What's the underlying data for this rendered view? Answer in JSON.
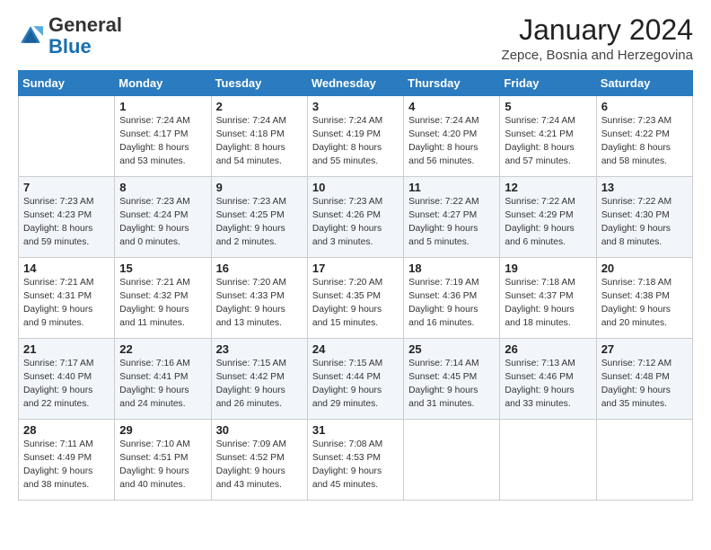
{
  "logo": {
    "general": "General",
    "blue": "Blue"
  },
  "header": {
    "month": "January 2024",
    "location": "Zepce, Bosnia and Herzegovina"
  },
  "days_of_week": [
    "Sunday",
    "Monday",
    "Tuesday",
    "Wednesday",
    "Thursday",
    "Friday",
    "Saturday"
  ],
  "weeks": [
    [
      {
        "day": "",
        "detail": ""
      },
      {
        "day": "1",
        "detail": "Sunrise: 7:24 AM\nSunset: 4:17 PM\nDaylight: 8 hours\nand 53 minutes."
      },
      {
        "day": "2",
        "detail": "Sunrise: 7:24 AM\nSunset: 4:18 PM\nDaylight: 8 hours\nand 54 minutes."
      },
      {
        "day": "3",
        "detail": "Sunrise: 7:24 AM\nSunset: 4:19 PM\nDaylight: 8 hours\nand 55 minutes."
      },
      {
        "day": "4",
        "detail": "Sunrise: 7:24 AM\nSunset: 4:20 PM\nDaylight: 8 hours\nand 56 minutes."
      },
      {
        "day": "5",
        "detail": "Sunrise: 7:24 AM\nSunset: 4:21 PM\nDaylight: 8 hours\nand 57 minutes."
      },
      {
        "day": "6",
        "detail": "Sunrise: 7:23 AM\nSunset: 4:22 PM\nDaylight: 8 hours\nand 58 minutes."
      }
    ],
    [
      {
        "day": "7",
        "detail": "Sunrise: 7:23 AM\nSunset: 4:23 PM\nDaylight: 8 hours\nand 59 minutes."
      },
      {
        "day": "8",
        "detail": "Sunrise: 7:23 AM\nSunset: 4:24 PM\nDaylight: 9 hours\nand 0 minutes."
      },
      {
        "day": "9",
        "detail": "Sunrise: 7:23 AM\nSunset: 4:25 PM\nDaylight: 9 hours\nand 2 minutes."
      },
      {
        "day": "10",
        "detail": "Sunrise: 7:23 AM\nSunset: 4:26 PM\nDaylight: 9 hours\nand 3 minutes."
      },
      {
        "day": "11",
        "detail": "Sunrise: 7:22 AM\nSunset: 4:27 PM\nDaylight: 9 hours\nand 5 minutes."
      },
      {
        "day": "12",
        "detail": "Sunrise: 7:22 AM\nSunset: 4:29 PM\nDaylight: 9 hours\nand 6 minutes."
      },
      {
        "day": "13",
        "detail": "Sunrise: 7:22 AM\nSunset: 4:30 PM\nDaylight: 9 hours\nand 8 minutes."
      }
    ],
    [
      {
        "day": "14",
        "detail": "Sunrise: 7:21 AM\nSunset: 4:31 PM\nDaylight: 9 hours\nand 9 minutes."
      },
      {
        "day": "15",
        "detail": "Sunrise: 7:21 AM\nSunset: 4:32 PM\nDaylight: 9 hours\nand 11 minutes."
      },
      {
        "day": "16",
        "detail": "Sunrise: 7:20 AM\nSunset: 4:33 PM\nDaylight: 9 hours\nand 13 minutes."
      },
      {
        "day": "17",
        "detail": "Sunrise: 7:20 AM\nSunset: 4:35 PM\nDaylight: 9 hours\nand 15 minutes."
      },
      {
        "day": "18",
        "detail": "Sunrise: 7:19 AM\nSunset: 4:36 PM\nDaylight: 9 hours\nand 16 minutes."
      },
      {
        "day": "19",
        "detail": "Sunrise: 7:18 AM\nSunset: 4:37 PM\nDaylight: 9 hours\nand 18 minutes."
      },
      {
        "day": "20",
        "detail": "Sunrise: 7:18 AM\nSunset: 4:38 PM\nDaylight: 9 hours\nand 20 minutes."
      }
    ],
    [
      {
        "day": "21",
        "detail": "Sunrise: 7:17 AM\nSunset: 4:40 PM\nDaylight: 9 hours\nand 22 minutes."
      },
      {
        "day": "22",
        "detail": "Sunrise: 7:16 AM\nSunset: 4:41 PM\nDaylight: 9 hours\nand 24 minutes."
      },
      {
        "day": "23",
        "detail": "Sunrise: 7:15 AM\nSunset: 4:42 PM\nDaylight: 9 hours\nand 26 minutes."
      },
      {
        "day": "24",
        "detail": "Sunrise: 7:15 AM\nSunset: 4:44 PM\nDaylight: 9 hours\nand 29 minutes."
      },
      {
        "day": "25",
        "detail": "Sunrise: 7:14 AM\nSunset: 4:45 PM\nDaylight: 9 hours\nand 31 minutes."
      },
      {
        "day": "26",
        "detail": "Sunrise: 7:13 AM\nSunset: 4:46 PM\nDaylight: 9 hours\nand 33 minutes."
      },
      {
        "day": "27",
        "detail": "Sunrise: 7:12 AM\nSunset: 4:48 PM\nDaylight: 9 hours\nand 35 minutes."
      }
    ],
    [
      {
        "day": "28",
        "detail": "Sunrise: 7:11 AM\nSunset: 4:49 PM\nDaylight: 9 hours\nand 38 minutes."
      },
      {
        "day": "29",
        "detail": "Sunrise: 7:10 AM\nSunset: 4:51 PM\nDaylight: 9 hours\nand 40 minutes."
      },
      {
        "day": "30",
        "detail": "Sunrise: 7:09 AM\nSunset: 4:52 PM\nDaylight: 9 hours\nand 43 minutes."
      },
      {
        "day": "31",
        "detail": "Sunrise: 7:08 AM\nSunset: 4:53 PM\nDaylight: 9 hours\nand 45 minutes."
      },
      {
        "day": "",
        "detail": ""
      },
      {
        "day": "",
        "detail": ""
      },
      {
        "day": "",
        "detail": ""
      }
    ]
  ]
}
